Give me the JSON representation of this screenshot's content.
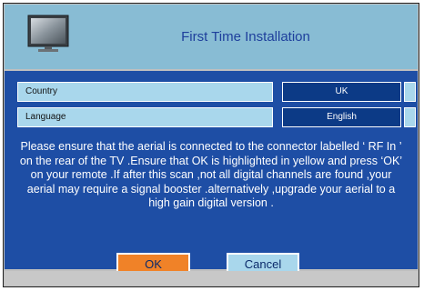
{
  "dialog": {
    "title": "First Time Installation",
    "icon": "tv-icon"
  },
  "settings": [
    {
      "label": "Country",
      "value": "UK"
    },
    {
      "label": "Language",
      "value": "English"
    }
  ],
  "message": "Please ensure that the aerial is connected to the connector labelled ‘ RF In ’ on the rear of the TV .Ensure that OK is highlighted in yellow and press ‘OK’ on your remote .If after this scan ,not all digital channels are found ,your aerial may require a signal booster .alternatively ,upgrade your aerial to a high gain digital version .",
  "buttons": {
    "ok_label": "OK",
    "cancel_label": "Cancel"
  },
  "colors": {
    "title_bar": "#88bcd4",
    "title_text": "#1e3f9c",
    "panel": "#1e4ea5",
    "value_cell": "#0c3a86",
    "label_cell": "#a9d7ec",
    "ok_highlight": "#f08228"
  }
}
